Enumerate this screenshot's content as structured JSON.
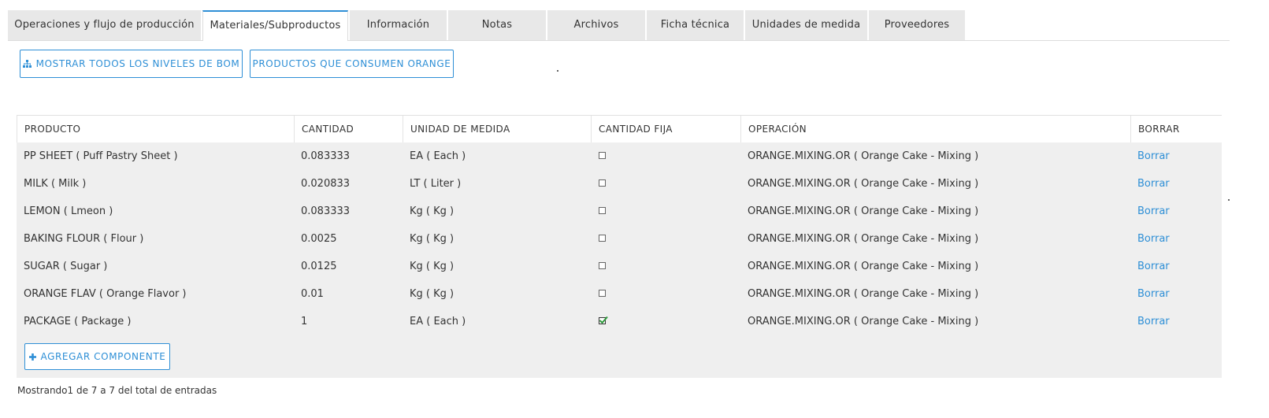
{
  "tabs": [
    {
      "label": "Operaciones y flujo de producción",
      "active": false
    },
    {
      "label": "Materiales/Subproductos",
      "active": true
    },
    {
      "label": "Información",
      "active": false
    },
    {
      "label": "Notas",
      "active": false
    },
    {
      "label": "Archivos",
      "active": false
    },
    {
      "label": "Ficha técnica",
      "active": false
    },
    {
      "label": "Unidades de medida",
      "active": false
    },
    {
      "label": "Proveedores",
      "active": false
    }
  ],
  "toolbar": {
    "bom_button_label": "MOSTRAR TODOS LOS NIVELES DE BOM",
    "bom_button_icon": "sitemap-icon",
    "consumers_button_label": "PRODUCTOS QUE CONSUMEN ORANGE"
  },
  "table": {
    "headers": {
      "producto": "PRODUCTO",
      "cantidad": "CANTIDAD",
      "unidad": "UNIDAD DE MEDIDA",
      "cantidad_fija": "CANTIDAD FIJA",
      "operacion": "OPERACIÓN",
      "borrar": "BORRAR"
    },
    "rows": [
      {
        "producto": "PP SHEET ( Puff Pastry Sheet )",
        "cantidad": "0.083333",
        "unidad": "EA ( Each )",
        "fija": false,
        "operacion": "ORANGE.MIXING.OR ( Orange Cake - Mixing )",
        "borrar": "Borrar"
      },
      {
        "producto": "MILK ( Milk )",
        "cantidad": "0.020833",
        "unidad": "LT ( Liter )",
        "fija": false,
        "operacion": "ORANGE.MIXING.OR ( Orange Cake - Mixing )",
        "borrar": "Borrar"
      },
      {
        "producto": "LEMON ( Lmeon )",
        "cantidad": "0.083333",
        "unidad": "Kg ( Kg )",
        "fija": false,
        "operacion": "ORANGE.MIXING.OR ( Orange Cake - Mixing )",
        "borrar": "Borrar"
      },
      {
        "producto": "BAKING FLOUR ( Flour )",
        "cantidad": "0.0025",
        "unidad": "Kg ( Kg )",
        "fija": false,
        "operacion": "ORANGE.MIXING.OR ( Orange Cake - Mixing )",
        "borrar": "Borrar"
      },
      {
        "producto": "SUGAR ( Sugar )",
        "cantidad": "0.0125",
        "unidad": "Kg ( Kg )",
        "fija": false,
        "operacion": "ORANGE.MIXING.OR ( Orange Cake - Mixing )",
        "borrar": "Borrar"
      },
      {
        "producto": "ORANGE FLAV ( Orange Flavor )",
        "cantidad": "0.01",
        "unidad": "Kg ( Kg )",
        "fija": false,
        "operacion": "ORANGE.MIXING.OR ( Orange Cake - Mixing )",
        "borrar": "Borrar"
      },
      {
        "producto": "PACKAGE ( Package )",
        "cantidad": "1",
        "unidad": "EA ( Each )",
        "fija": true,
        "operacion": "ORANGE.MIXING.OR ( Orange Cake - Mixing )",
        "borrar": "Borrar"
      }
    ],
    "add_button_label": "AGREGAR COMPONENTE",
    "add_button_icon": "plus-icon"
  },
  "footer": {
    "info": "Mostrando1 de 7 a 7 del total de entradas"
  },
  "colors": {
    "accent": "#2e8fd6",
    "check": "#2e9a3c",
    "tab_bg": "#e8e8e8",
    "table_bg": "#efefef"
  }
}
